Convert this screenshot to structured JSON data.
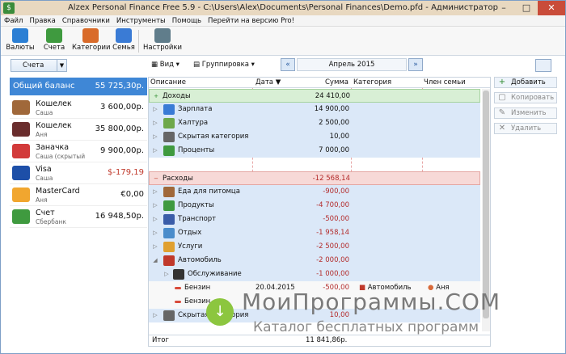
{
  "window": {
    "title": "Alzex Personal Finance Free 5.9 - C:\\Users\\Alex\\Documents\\Personal Finances\\Demo.pfd - Администратор"
  },
  "menu": [
    "Файл",
    "Правка",
    "Справочники",
    "Инструменты",
    "Помощь",
    "Перейти на версию Pro!"
  ],
  "toolbar": [
    {
      "label": "Валюты",
      "icon": "currencies-icon"
    },
    {
      "label": "Счета",
      "icon": "accounts-icon"
    },
    {
      "label": "Категории",
      "icon": "categories-icon"
    },
    {
      "label": "Семья",
      "icon": "family-icon"
    },
    {
      "label": "Настройки",
      "icon": "settings-icon"
    }
  ],
  "left": {
    "accounts_dropdown": "Счета",
    "balance_label": "Общий баланс",
    "balance_value": "55 725,30р.",
    "accounts": [
      {
        "name": "Кошелек",
        "sub": "Саша",
        "value": "3 600,00р.",
        "color": "#a0683a",
        "value_color": "#111"
      },
      {
        "name": "Кошелек",
        "sub": "Аня",
        "value": "35 800,00р.",
        "color": "#6a2d2d",
        "value_color": "#111"
      },
      {
        "name": "Заначка",
        "sub": "Саша (скрытый",
        "value": "9 900,00р.",
        "color": "#d23a3a",
        "value_color": "#111"
      },
      {
        "name": "Visa",
        "sub": "Саша",
        "value": "$-179,19",
        "color": "#1d4fa8",
        "value_color": "#c0392b"
      },
      {
        "name": "MasterCard",
        "sub": "Аня",
        "value": "€0,00",
        "color": "#f1a62f",
        "value_color": "#111"
      },
      {
        "name": "Счет",
        "sub": "Сбербанк",
        "value": "16 948,50р.",
        "color": "#3f9a3f",
        "value_color": "#111"
      }
    ]
  },
  "viewbar": {
    "view": "Вид",
    "grouping": "Группировка",
    "period": "Апрель 2015"
  },
  "table": {
    "headers": {
      "desc": "Описание",
      "date": "Дата",
      "amount": "Сумма",
      "category": "Категория",
      "member": "Член семьи"
    },
    "rows": [
      {
        "type": "group-income",
        "name": "Доходы",
        "amount": "24 410,00"
      },
      {
        "type": "income",
        "name": "Зарплата",
        "amount": "14 900,00",
        "icon": "#3a7bd5"
      },
      {
        "type": "income",
        "name": "Халтура",
        "amount": "2 500,00",
        "icon": "#6ea84a"
      },
      {
        "type": "income",
        "name": "Скрытая категория",
        "amount": "10,00",
        "icon": "#666"
      },
      {
        "type": "income",
        "name": "Проценты",
        "amount": "7 000,00",
        "icon": "#3f9a3f"
      },
      {
        "type": "gap"
      },
      {
        "type": "group-expense",
        "name": "Расходы",
        "amount": "-12 568,14"
      },
      {
        "type": "expense",
        "name": "Еда для питомца",
        "amount": "-900,00",
        "icon": "#a0683a"
      },
      {
        "type": "expense",
        "name": "Продукты",
        "amount": "-4 700,00",
        "icon": "#3f9a3f"
      },
      {
        "type": "expense",
        "name": "Транспорт",
        "amount": "-500,00",
        "icon": "#3a5ca8"
      },
      {
        "type": "expense",
        "name": "Отдых",
        "amount": "-1 958,14",
        "icon": "#4a8ccb"
      },
      {
        "type": "expense",
        "name": "Услуги",
        "amount": "-2 500,00",
        "icon": "#e0a030"
      },
      {
        "type": "expense-open",
        "name": "Автомобиль",
        "amount": "-2 000,00",
        "icon": "#c0392b"
      },
      {
        "type": "sub",
        "name": "Обслуживание",
        "amount": "-1 000,00",
        "icon": "#333"
      },
      {
        "type": "txn",
        "name": "Бензин",
        "date": "20.04.2015",
        "amount": "-500,00",
        "category": "Автомобиль",
        "member": "Аня"
      },
      {
        "type": "txn",
        "name": "Бензин",
        "date": "",
        "amount": "",
        "category": "",
        "member": ""
      },
      {
        "type": "expense",
        "name": "Скрытая категория",
        "amount": "10,00",
        "icon": "#666"
      }
    ],
    "total_label": "Итог",
    "total_value": "11 841,86р."
  },
  "actions": [
    {
      "label": "Добавить",
      "icon": "+",
      "enabled": true
    },
    {
      "label": "Копировать",
      "icon": "▢",
      "enabled": false
    },
    {
      "label": "Изменить",
      "icon": "✎",
      "enabled": false
    },
    {
      "label": "Удалить",
      "icon": "✕",
      "enabled": false
    }
  ],
  "watermark": {
    "title": "МоиПрограммы.СОМ",
    "subtitle": "Каталог бесплатных программ"
  }
}
